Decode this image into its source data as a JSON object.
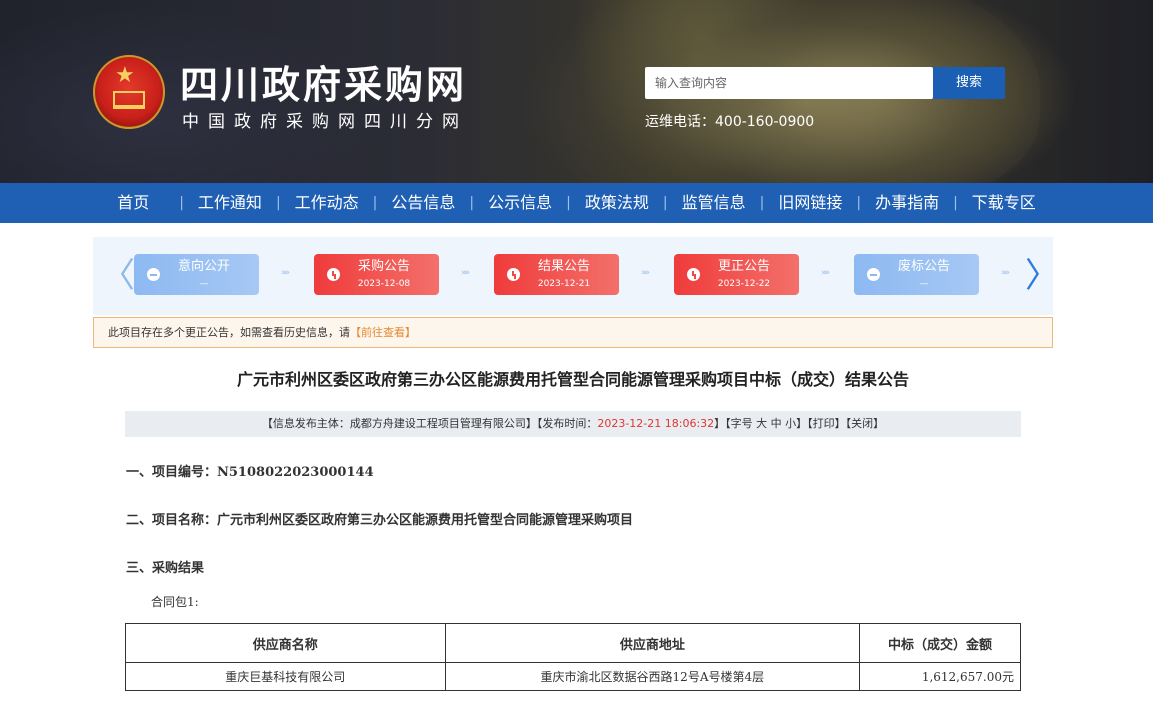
{
  "header": {
    "site_title": "四川政府采购网",
    "site_subtitle": "中国政府采购网四川分网",
    "search_placeholder": "输入查询内容",
    "search_button": "搜索",
    "hotline": "运维电话：400-160-0900"
  },
  "nav": {
    "items": [
      "首页",
      "工作通知",
      "工作动态",
      "公告信息",
      "公示信息",
      "政策法规",
      "监管信息",
      "旧网链接",
      "办事指南",
      "下载专区"
    ]
  },
  "timeline": {
    "cards": [
      {
        "label": "意向公开",
        "date": "—",
        "active": false
      },
      {
        "label": "采购公告",
        "date": "2023-12-08",
        "active": true
      },
      {
        "label": "结果公告",
        "date": "2023-12-21",
        "active": true
      },
      {
        "label": "更正公告",
        "date": "2023-12-22",
        "active": true
      },
      {
        "label": "废标公告",
        "date": "—",
        "active": false
      }
    ],
    "prev_arrow": "〈",
    "next_arrow": "〉",
    "chevron": "»»"
  },
  "notice": {
    "text": "此项目存在多个更正公告，如需查看历史信息，请",
    "link": "【前往查看】"
  },
  "article": {
    "title": "广元市利州区委区政府第三办公区能源费用托管型合同能源管理采购项目中标（成交）结果公告",
    "info": {
      "publisher": "【信息发布主体：成都方舟建设工程项目管理有限公司】【发布时间：",
      "time": "2023-12-21 18:06:32",
      "tail": "】【字号 大 中 小】【打印】【关闭】"
    },
    "section1": "一、项目编号：N5108022023000144",
    "section2": "二、项目名称：广元市利州区委区政府第三办公区能源费用托管型合同能源管理采购项目",
    "section3": "三、采购结果",
    "package_label": "合同包1:",
    "table": {
      "headers": [
        "供应商名称",
        "供应商地址",
        "中标（成交）金额"
      ],
      "rows": [
        [
          "重庆巨基科技有限公司",
          "重庆市渝北区数据谷西路12号A号楼第4层",
          "1,612,657.00元"
        ]
      ]
    }
  }
}
